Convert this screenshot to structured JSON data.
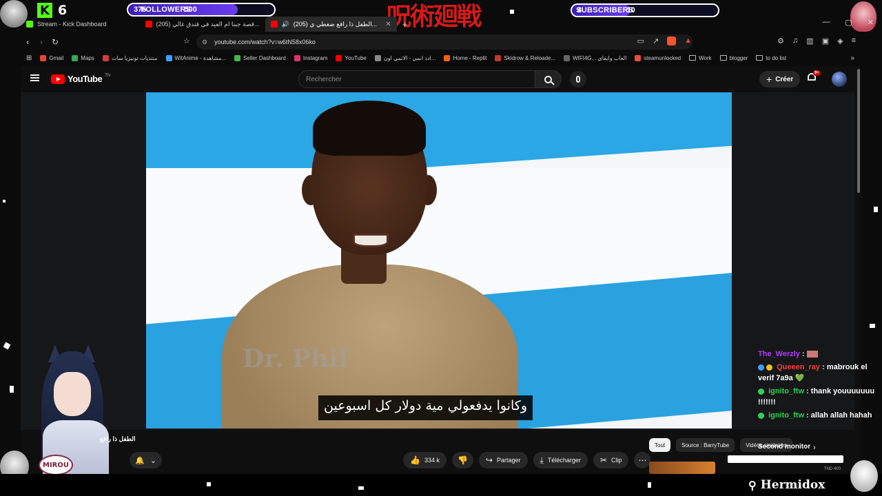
{
  "overlay": {
    "kick_count": "6",
    "followers_goal": {
      "current": "375",
      "label": "FOLLOWERS",
      "max": "500",
      "fraction": 0.75
    },
    "subscribers_goal": {
      "current": "4",
      "label": "SUBSCRIBERS",
      "max": "10",
      "fraction": 0.4
    },
    "banner_title": "呪術廻戦",
    "vtuber_name": "MIROU",
    "overlay_video_title": "الطفل ذا رافع",
    "brand": "Hermidox",
    "second_monitor": "Second monitor",
    "chat": [
      {
        "user": "The_Werzly",
        "user_color": "#b23bff",
        "text": ""
      },
      {
        "user": "Queeen_ray",
        "user_color": "#ff3b3b",
        "text": "mabrouk el verif 7a9a",
        "heart": "💚"
      },
      {
        "user": "ignito_ftw",
        "user_color": "#2fd158",
        "text": "thank youuuuuuu !!!!!!!"
      },
      {
        "user": "ignito_ftw",
        "user_color": "#2fd158",
        "text": "allah allah hahah"
      }
    ]
  },
  "browser": {
    "tabs": [
      {
        "title": "Stream - Kick Dashboard",
        "fav_color": "#53fc18",
        "active": false
      },
      {
        "title": "(205) قصة جبنا ام العيد في فندق غالي...",
        "fav_color": "#ff0000",
        "active": false
      },
      {
        "title": "(205) الطفل ذا رافع ضغطي ي...",
        "fav_color": "#ff0000",
        "active": true
      }
    ],
    "new_tab": "+",
    "window_controls": [
      "—",
      "▢",
      "✕"
    ],
    "url": "youtube.com/watch?v=w6tN58x06ko",
    "bookmarks": [
      {
        "label": "Gmail",
        "color": "#ea4335"
      },
      {
        "label": "Maps",
        "color": "#34a853"
      },
      {
        "label": "منتديات تونيزيا سات",
        "color": "#d63a3a"
      },
      {
        "label": "WitAnime - مشاهدة...",
        "color": "#3aa0ff"
      },
      {
        "label": "Seller Dashboard",
        "color": "#3fb950"
      },
      {
        "label": "Instagram",
        "color": "#e1306c"
      },
      {
        "label": "YouTube",
        "color": "#ff0000"
      },
      {
        "label": "ادد انمي - الانمي اون...",
        "color": "#888888"
      },
      {
        "label": "Home - Replit",
        "color": "#f26207"
      },
      {
        "label": "Skidrow & Reloade...",
        "color": "#c0392b"
      },
      {
        "label": "WIFI4G... العاب وايفاي",
        "color": "#666666"
      },
      {
        "label": "steamunlocked",
        "color": "#e74c3c"
      },
      {
        "label": "Work",
        "color": "folder"
      },
      {
        "label": "blogger",
        "color": "folder"
      },
      {
        "label": "to do list",
        "color": "folder"
      }
    ]
  },
  "youtube": {
    "logo_text": "YouTube",
    "logo_tm": "TN",
    "search_placeholder": "Rechercher",
    "create_label": "Créer",
    "notifications_badge": "9+",
    "subtitle": "وكانوا يدفعولي مية دولار كل اسبوعين",
    "watermark": "Dr. Phil",
    "actions": {
      "likes": "334 k",
      "share": "Partager",
      "download": "Télécharger",
      "clip": "Clip"
    },
    "chips": [
      "Tout",
      "Source : BarryTube",
      "Vidéos similaires"
    ],
    "rec_price": "TND 400"
  }
}
